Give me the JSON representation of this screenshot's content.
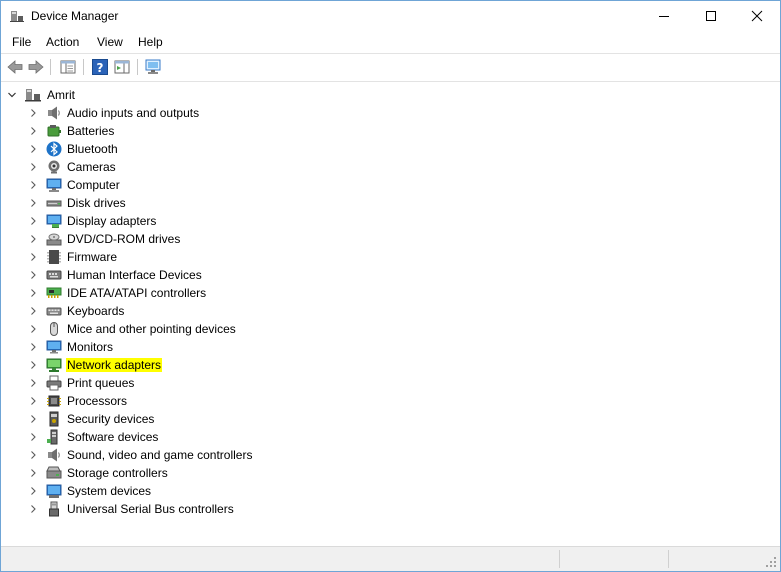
{
  "window": {
    "title": "Device Manager"
  },
  "menu": [
    "File",
    "Action",
    "View",
    "Help"
  ],
  "tree": {
    "root": "Amrit",
    "items": [
      {
        "label": "Audio inputs and outputs",
        "icon": "speaker-icon",
        "highlight": false
      },
      {
        "label": "Batteries",
        "icon": "battery-icon",
        "highlight": false
      },
      {
        "label": "Bluetooth",
        "icon": "bluetooth-icon",
        "highlight": false
      },
      {
        "label": "Cameras",
        "icon": "camera-icon",
        "highlight": false
      },
      {
        "label": "Computer",
        "icon": "computer-icon",
        "highlight": false
      },
      {
        "label": "Disk drives",
        "icon": "disk-drive-icon",
        "highlight": false
      },
      {
        "label": "Display adapters",
        "icon": "display-adapter-icon",
        "highlight": false
      },
      {
        "label": "DVD/CD-ROM drives",
        "icon": "dvd-drive-icon",
        "highlight": false
      },
      {
        "label": "Firmware",
        "icon": "firmware-icon",
        "highlight": false
      },
      {
        "label": "Human Interface Devices",
        "icon": "hid-icon",
        "highlight": false
      },
      {
        "label": "IDE ATA/ATAPI controllers",
        "icon": "ide-controller-icon",
        "highlight": false
      },
      {
        "label": "Keyboards",
        "icon": "keyboard-icon",
        "highlight": false
      },
      {
        "label": "Mice and other pointing devices",
        "icon": "mouse-icon",
        "highlight": false
      },
      {
        "label": "Monitors",
        "icon": "monitor-icon",
        "highlight": false
      },
      {
        "label": "Network adapters",
        "icon": "network-adapter-icon",
        "highlight": true
      },
      {
        "label": "Print queues",
        "icon": "printer-icon",
        "highlight": false
      },
      {
        "label": "Processors",
        "icon": "processor-icon",
        "highlight": false
      },
      {
        "label": "Security devices",
        "icon": "security-device-icon",
        "highlight": false
      },
      {
        "label": "Software devices",
        "icon": "software-device-icon",
        "highlight": false
      },
      {
        "label": "Sound, video and game controllers",
        "icon": "speaker-icon",
        "highlight": false
      },
      {
        "label": "Storage controllers",
        "icon": "storage-controller-icon",
        "highlight": false
      },
      {
        "label": "System devices",
        "icon": "system-device-icon",
        "highlight": false
      },
      {
        "label": "Universal Serial Bus controllers",
        "icon": "usb-icon",
        "highlight": false
      }
    ]
  },
  "colors": {
    "highlight": "#ffff00",
    "accent": "#1e73c8",
    "border": "#6fa5d6"
  }
}
